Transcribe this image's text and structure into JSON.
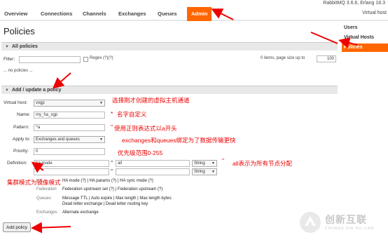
{
  "header": {
    "version": "RabbitMQ 3.6.6, Erlang 18.3",
    "vhost": "Virtual host"
  },
  "nav": {
    "tabs": [
      "Overview",
      "Connections",
      "Channels",
      "Exchanges",
      "Queues",
      "Admin"
    ],
    "active": "Admin"
  },
  "sidebar": {
    "items": [
      "Users",
      "Virtual Hosts",
      "Policies"
    ],
    "active": "Policies"
  },
  "page": {
    "title": "Policies"
  },
  "all_policies": {
    "heading": "All policies",
    "filter_label": "Filter:",
    "filter_value": "",
    "regex_label": "Regex (?)(?)",
    "items_text": "0 items, page size up to",
    "page_size": "100",
    "empty_text": "... no policies ..."
  },
  "add_policy": {
    "heading": "Add / update a policy",
    "virtual_host_label": "Virtual host:",
    "virtual_host_value": "vxgp",
    "name_label": "Name:",
    "name_value": "my_ha_xgp",
    "pattern_label": "Pattern:",
    "pattern_value": "^a",
    "apply_label": "Apply to:",
    "apply_value": "Exchanges and queues",
    "priority_label": "Priority:",
    "priority_value": "0",
    "definition_label": "Definition:",
    "def_key_1": "ha-mode",
    "def_val_1": "all",
    "def_key_2": "",
    "def_val_2": "",
    "type_1": "String",
    "type_2": "String",
    "equals": "=",
    "required_mark": "*",
    "ha_label": "HA",
    "ha_links": "HA mode (?) | HA params (?) | HA sync mode (?)",
    "federation_label": "Federation",
    "federation_links": "Federation upstream set (?) | Federation upstream (?)",
    "queues_label": "Queues",
    "queues_line1": "Message TTL | Auto expire | Max length | Max length bytes",
    "queues_line2": "Dead letter exchange | Dead letter routing key",
    "exchanges_label": "Exchanges",
    "exchanges_links": "Alternate exchange",
    "add_button": "Add policy"
  },
  "annotations": {
    "vhost_note": "选择刚才创建的虚拟主机通道",
    "name_note": "名字自定义",
    "pattern_note": "使用正则表达式以a开头",
    "apply_note": "exchanges和queues绑定为了数据传输更快",
    "priority_note": "优先级范围0-255",
    "definition_note": "all表示为所有节点分配",
    "cluster_note": "集群模式为镜像模式",
    "star": "*",
    "quote": "\""
  },
  "logo": {
    "cn": "创新互联",
    "en": "CHUANG XIN HU LIAN"
  },
  "colors": {
    "accent": "#ff6600",
    "annotation": "#e00000"
  }
}
